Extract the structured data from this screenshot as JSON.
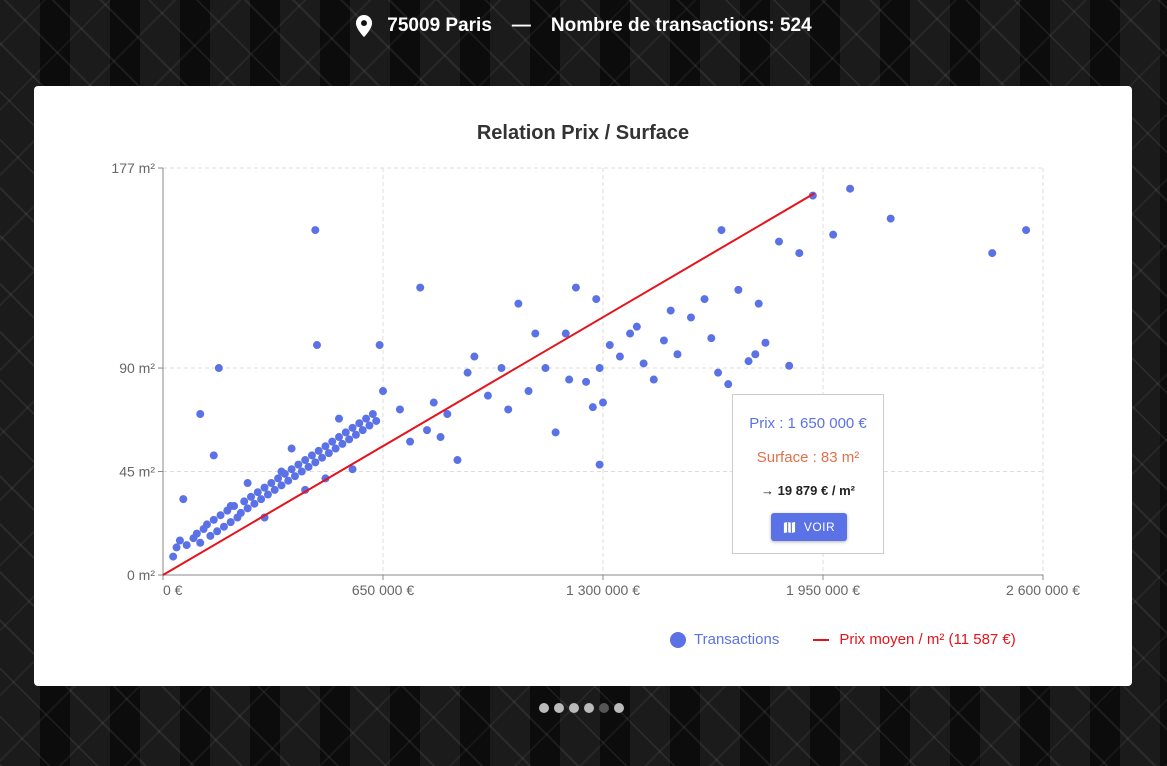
{
  "header": {
    "location": "75009 Paris",
    "separator": "—",
    "count_label": "Nombre de transactions: 524"
  },
  "chart_data": {
    "type": "scatter",
    "title": "Relation Prix / Surface",
    "x_ticks": [
      "0 €",
      "650 000 €",
      "1 300 000 €",
      "1 950 000 €",
      "2 600 000 €"
    ],
    "x_tick_values": [
      0,
      650000,
      1300000,
      1950000,
      2600000
    ],
    "y_ticks": [
      "0 m²",
      "45 m²",
      "90 m²",
      "177 m²"
    ],
    "y_tick_values": [
      0,
      45,
      90,
      177
    ],
    "xlim": [
      0,
      2600000
    ],
    "ylim": [
      0,
      177
    ],
    "grid": true,
    "legend_position": "bottom-right",
    "series": [
      {
        "name": "Transactions",
        "type": "scatter",
        "color": "#5b72e6"
      },
      {
        "name": "Prix moyen / m²",
        "type": "line",
        "color": "#e5131b",
        "label_suffix": "(11 587 €)",
        "line": [
          [
            0,
            0
          ],
          [
            1925000,
            166
          ]
        ]
      }
    ],
    "points": [
      [
        30000,
        8
      ],
      [
        40000,
        12
      ],
      [
        50000,
        15
      ],
      [
        70000,
        13
      ],
      [
        60000,
        33
      ],
      [
        90000,
        16
      ],
      [
        100000,
        18
      ],
      [
        110000,
        14
      ],
      [
        120000,
        20
      ],
      [
        130000,
        22
      ],
      [
        140000,
        17
      ],
      [
        150000,
        24
      ],
      [
        160000,
        19
      ],
      [
        170000,
        26
      ],
      [
        180000,
        21
      ],
      [
        190000,
        28
      ],
      [
        200000,
        23
      ],
      [
        210000,
        30
      ],
      [
        220000,
        25
      ],
      [
        230000,
        27
      ],
      [
        240000,
        32
      ],
      [
        250000,
        29
      ],
      [
        260000,
        34
      ],
      [
        270000,
        31
      ],
      [
        280000,
        36
      ],
      [
        290000,
        33
      ],
      [
        300000,
        38
      ],
      [
        310000,
        35
      ],
      [
        320000,
        40
      ],
      [
        330000,
        37
      ],
      [
        340000,
        42
      ],
      [
        350000,
        39
      ],
      [
        360000,
        44
      ],
      [
        370000,
        41
      ],
      [
        380000,
        46
      ],
      [
        390000,
        43
      ],
      [
        400000,
        48
      ],
      [
        410000,
        45
      ],
      [
        420000,
        50
      ],
      [
        430000,
        47
      ],
      [
        440000,
        52
      ],
      [
        450000,
        49
      ],
      [
        460000,
        54
      ],
      [
        470000,
        51
      ],
      [
        480000,
        56
      ],
      [
        490000,
        53
      ],
      [
        500000,
        58
      ],
      [
        510000,
        55
      ],
      [
        520000,
        60
      ],
      [
        530000,
        57
      ],
      [
        540000,
        62
      ],
      [
        550000,
        59
      ],
      [
        560000,
        64
      ],
      [
        570000,
        61
      ],
      [
        580000,
        66
      ],
      [
        590000,
        63
      ],
      [
        600000,
        68
      ],
      [
        610000,
        65
      ],
      [
        620000,
        70
      ],
      [
        630000,
        67
      ],
      [
        110000,
        70
      ],
      [
        165000,
        90
      ],
      [
        150000,
        52
      ],
      [
        450000,
        150
      ],
      [
        455000,
        100
      ],
      [
        640000,
        100
      ],
      [
        300000,
        25
      ],
      [
        250000,
        40
      ],
      [
        200000,
        30
      ],
      [
        350000,
        45
      ],
      [
        420000,
        37
      ],
      [
        380000,
        55
      ],
      [
        480000,
        42
      ],
      [
        520000,
        68
      ],
      [
        560000,
        46
      ],
      [
        650000,
        80
      ],
      [
        700000,
        72
      ],
      [
        760000,
        125
      ],
      [
        730000,
        58
      ],
      [
        780000,
        63
      ],
      [
        800000,
        75
      ],
      [
        820000,
        60
      ],
      [
        840000,
        70
      ],
      [
        870000,
        50
      ],
      [
        900000,
        88
      ],
      [
        920000,
        95
      ],
      [
        960000,
        78
      ],
      [
        1000000,
        90
      ],
      [
        1020000,
        72
      ],
      [
        1050000,
        118
      ],
      [
        1080000,
        80
      ],
      [
        1100000,
        105
      ],
      [
        1130000,
        90
      ],
      [
        1160000,
        62
      ],
      [
        1190000,
        105
      ],
      [
        1220000,
        125
      ],
      [
        1250000,
        84
      ],
      [
        1280000,
        120
      ],
      [
        1290000,
        90
      ],
      [
        1300000,
        75
      ],
      [
        1320000,
        100
      ],
      [
        1350000,
        95
      ],
      [
        1380000,
        105
      ],
      [
        1400000,
        108
      ],
      [
        1420000,
        92
      ],
      [
        1450000,
        85
      ],
      [
        1480000,
        102
      ],
      [
        1500000,
        115
      ],
      [
        1520000,
        96
      ],
      [
        1560000,
        112
      ],
      [
        1600000,
        120
      ],
      [
        1620000,
        103
      ],
      [
        1650000,
        150
      ],
      [
        1670000,
        83
      ],
      [
        1700000,
        124
      ],
      [
        1730000,
        93
      ],
      [
        1760000,
        118
      ],
      [
        1780000,
        101
      ],
      [
        1820000,
        145
      ],
      [
        1850000,
        91
      ],
      [
        1880000,
        140
      ],
      [
        1920000,
        165
      ],
      [
        1980000,
        148
      ],
      [
        2030000,
        168
      ],
      [
        2150000,
        155
      ],
      [
        2450000,
        140
      ],
      [
        2550000,
        150
      ],
      [
        1290000,
        48
      ],
      [
        1270000,
        73
      ],
      [
        1200000,
        85
      ],
      [
        1640000,
        88
      ],
      [
        1750000,
        96
      ]
    ]
  },
  "tooltip": {
    "price": "Prix : 1 650 000 €",
    "surface": "Surface : 83 m²",
    "price_per_m2": "→ 19 879 € / m²",
    "button_label": "VOIR"
  },
  "legend": {
    "transactions": "Transactions",
    "avg_price": "Prix moyen / m²  (11 587 €)"
  },
  "carousel": {
    "dot_count": 6,
    "active_index": 4
  }
}
